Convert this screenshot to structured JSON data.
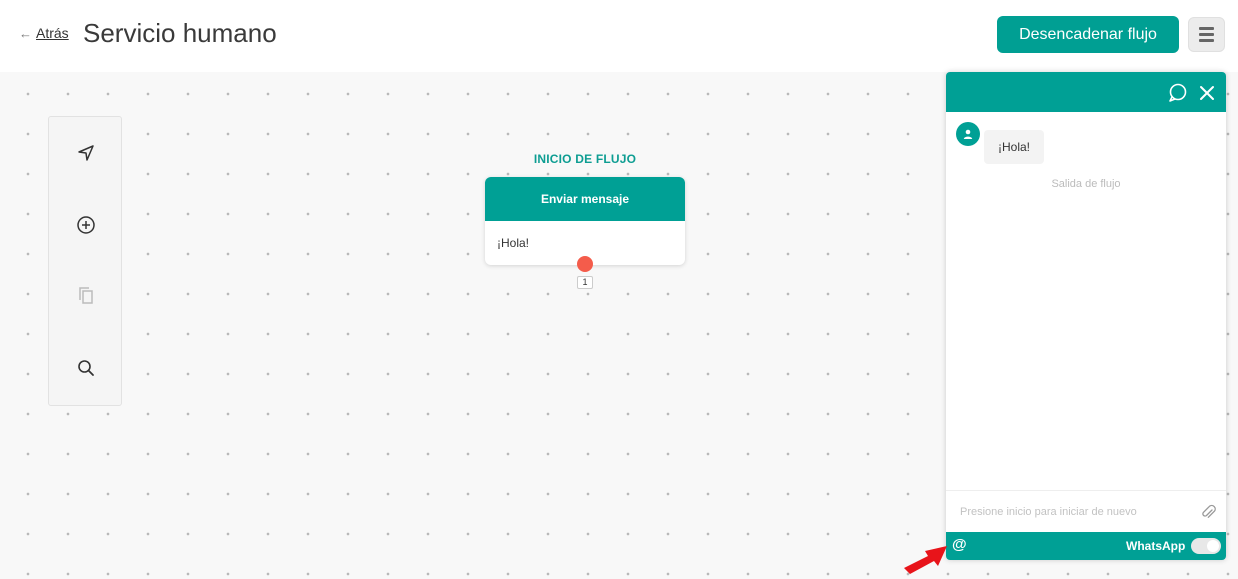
{
  "header": {
    "back_arrow": "←",
    "back_label": "Atrás",
    "title": "Servicio humano",
    "trigger_label": "Desencadenar flujo"
  },
  "toolbar": {
    "icons": [
      "navigate-icon",
      "add-circle-icon",
      "copy-icon",
      "search-icon"
    ]
  },
  "flow": {
    "start_label": "INICIO DE FLUJO",
    "node_title": "Enviar mensaje",
    "node_message": "¡Hola!",
    "port_index": "1"
  },
  "chat": {
    "bot_message": "¡Hola!",
    "system_text": "Salida de flujo",
    "input_placeholder": "Presione inicio para iniciar de nuevo",
    "input_value": "",
    "channel_label": "WhatsApp",
    "at_symbol": "@"
  },
  "colors": {
    "brand": "#00a095",
    "port": "#f45c4b",
    "annotation_arrow": "#e8141a"
  }
}
